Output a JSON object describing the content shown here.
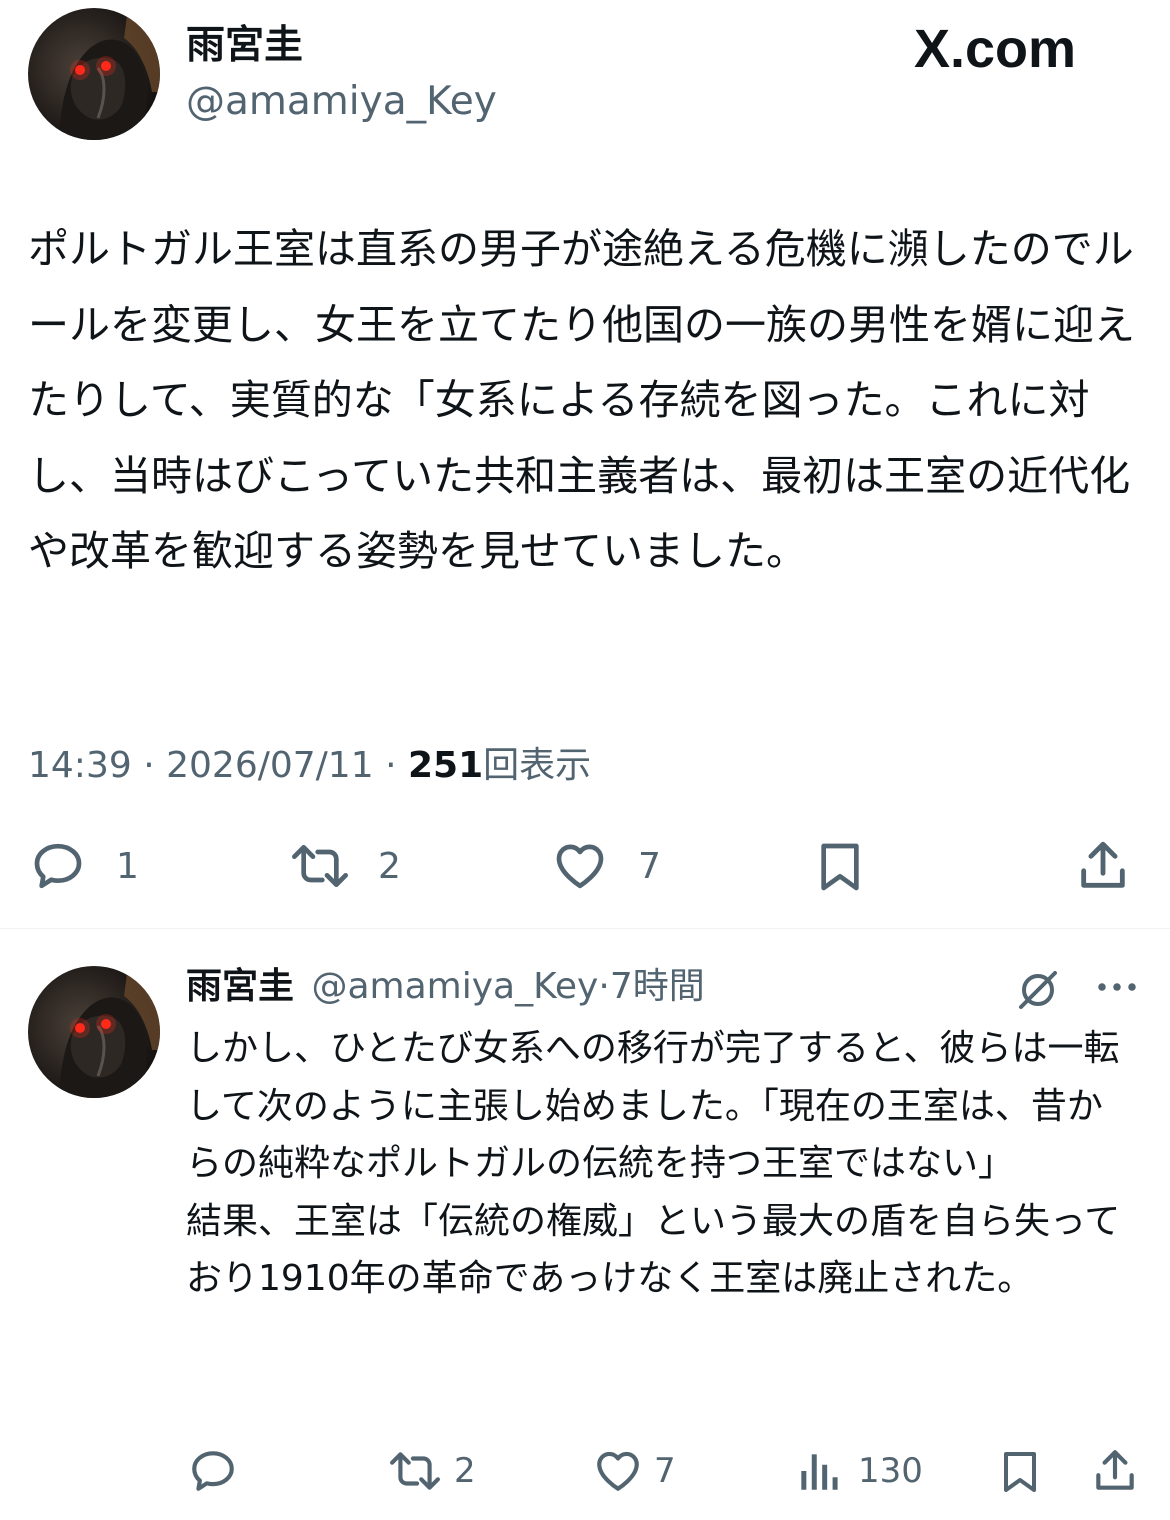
{
  "site_logo": "X.com",
  "tweet": {
    "author_name": "雨宮圭",
    "author_handle": "@amamiya_Key",
    "text": "ポルトガル王室は直系の男子が途絶える危機に瀕したのでルールを変更し、女王を立てたり他国の一族の男性を婿に迎えたりして、実質的な「女系による存続を図った。これに対し、当時はびこっていた共和主義者は、最初は王室の近代化や改革を歓迎する姿勢を見せていました。",
    "time": "14:39",
    "separator": "·",
    "date": "2026/07/11",
    "views_count": "251",
    "views_label": "回表示",
    "replies": "1",
    "retweets": "2",
    "likes": "7"
  },
  "reply": {
    "author_name": "雨宮圭",
    "author_handle": "@amamiya_Key",
    "separator": "·",
    "age": "7時間",
    "text": "しかし、ひとたび女系への移行が完了すると、彼らは一転して次のように主張し始めました。「現在の王室は、昔からの純粋なポルトガルの伝統を持つ王室ではない」\n結果、王室は「伝統の権威」という最大の盾を自ら失っており1910年の革命であっけなく王室は廃止された。",
    "replies": "",
    "retweets": "2",
    "likes": "7",
    "views": "130"
  },
  "icons": {
    "reply": "reply-icon",
    "retweet": "retweet-icon",
    "like": "heart-icon",
    "bookmark": "bookmark-icon",
    "share": "share-icon",
    "views": "views-icon",
    "grok": "grok-icon",
    "more": "more-icon"
  },
  "colors": {
    "text": "#0f1419",
    "secondary": "#536471",
    "divider": "#eff3f4"
  }
}
